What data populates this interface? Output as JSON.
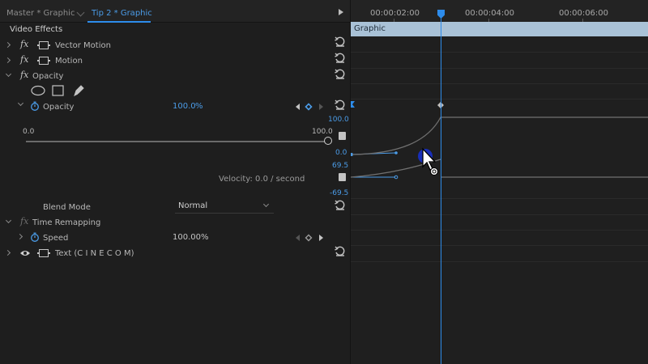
{
  "tabs": {
    "master": "Master * Graphic",
    "active": "Tip 2 * Graphic"
  },
  "panel": {
    "section_title": "Video Effects",
    "effects": {
      "vector_motion": "Vector Motion",
      "motion": "Motion",
      "opacity": "Opacity",
      "time_remapping": "Time Remapping",
      "text_layer": "Text (C I N E C O M)"
    },
    "opacity_prop": {
      "label": "Opacity",
      "value": "100.0",
      "unit": "%",
      "slider_min": "0.0",
      "slider_max": "100.0",
      "slider_fraction": 1.0
    },
    "velocity_label": "Velocity: 0.0 / second",
    "blend_mode": {
      "label": "Blend Mode",
      "value": "Normal"
    },
    "speed_prop": {
      "label": "Speed",
      "value": "100.00%"
    }
  },
  "timeline": {
    "timecodes": [
      "00:00:02:00",
      "00:00:04:00",
      "00:00:06:00"
    ],
    "clip_name": "Graphic",
    "value_graph": {
      "top": "100.0",
      "bottom": "0.0"
    },
    "velocity_graph": {
      "top": "69.5",
      "bottom": "-69.5"
    }
  },
  "colors": {
    "accent": "#2d8ceb",
    "clip": "#a9c2d7",
    "background": "#1e1e1e"
  },
  "icons": {
    "reset": "reset-icon",
    "stopwatch": "stopwatch-icon",
    "ellipse_mask": "ellipse-mask-icon",
    "rect_mask": "rectangle-mask-icon",
    "pen_mask": "pen-mask-icon",
    "eye": "eye-icon"
  }
}
